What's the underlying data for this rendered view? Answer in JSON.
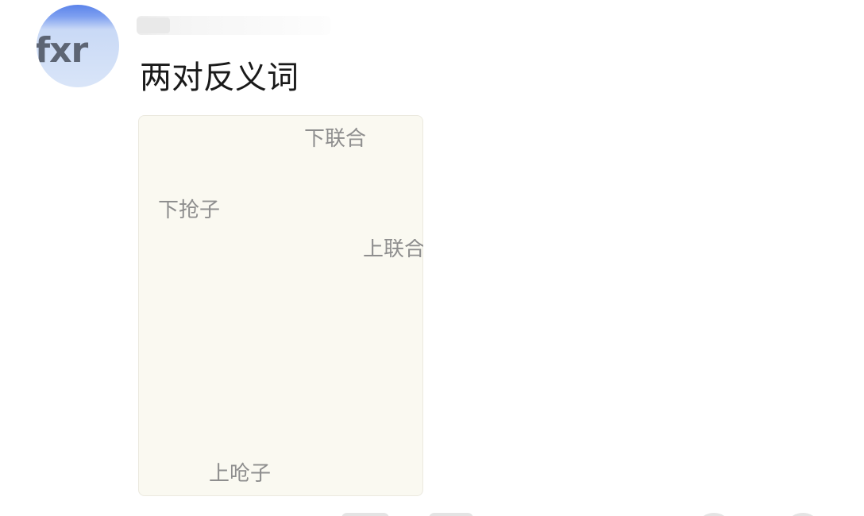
{
  "user": {
    "avatar_text": "fxr"
  },
  "post": {
    "text": "两对反义词"
  },
  "image_card": {
    "labels": [
      "下联合",
      "下抢子",
      "上联合",
      "上呛子"
    ],
    "background_color": "#faf9f1"
  },
  "actions": {
    "icons": [
      "comment-icon",
      "like-icon"
    ]
  }
}
